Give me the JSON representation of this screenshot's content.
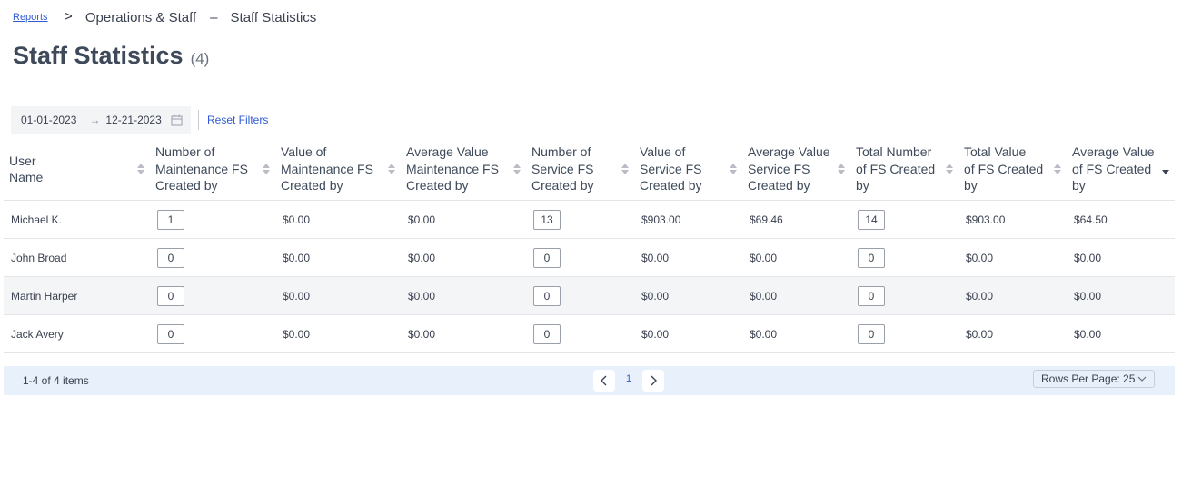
{
  "breadcrumb": {
    "root": "Reports",
    "separator": ">",
    "section": "Operations & Staff",
    "dash": "–",
    "current": "Staff Statistics"
  },
  "page": {
    "title": "Staff Statistics",
    "count": "(4)"
  },
  "filters": {
    "start_date": "01-01-2023",
    "arrow": "→",
    "end_date": "12-21-2023",
    "reset_label": "Reset Filters"
  },
  "table": {
    "columns": [
      [
        "User",
        "Name"
      ],
      [
        "Number of",
        "Maintenance FS",
        "Created by"
      ],
      [
        "Value of",
        "Maintenance FS",
        "Created by"
      ],
      [
        "Average Value",
        "Maintenance FS",
        "Created by"
      ],
      [
        "Number of",
        "Service FS",
        "Created by"
      ],
      [
        "Value of",
        "Service FS",
        "Created by"
      ],
      [
        "Average Value",
        "Service FS",
        "Created by"
      ],
      [
        "Total Number",
        "of FS Created",
        "by"
      ],
      [
        "Total Value",
        "of FS Created",
        "by"
      ],
      [
        "Average Value",
        "of FS Created",
        "by"
      ]
    ],
    "rows": [
      [
        "Michael K.",
        "1",
        "$0.00",
        "$0.00",
        "13",
        "$903.00",
        "$69.46",
        "14",
        "$903.00",
        "$64.50"
      ],
      [
        "John Broad",
        "0",
        "$0.00",
        "$0.00",
        "0",
        "$0.00",
        "$0.00",
        "0",
        "$0.00",
        "$0.00"
      ],
      [
        "Martin Harper",
        "0",
        "$0.00",
        "$0.00",
        "0",
        "$0.00",
        "$0.00",
        "0",
        "$0.00",
        "$0.00"
      ],
      [
        "Jack Avery",
        "0",
        "$0.00",
        "$0.00",
        "0",
        "$0.00",
        "$0.00",
        "0",
        "$0.00",
        "$0.00"
      ]
    ]
  },
  "pagination": {
    "info": "1-4 of 4 items",
    "current_page": "1",
    "rows_per_page_label": "Rows Per Page: 25"
  },
  "icons": {
    "calendar": "calendar-icon",
    "prev": "chevron-left-icon",
    "next": "chevron-right-icon",
    "dropdown": "chevron-down-icon",
    "sort": "sort-icon"
  },
  "colors": {
    "link": "#2f5bd3",
    "pager_bg": "#e8f0fb",
    "shaded_row": "#f4f5f7"
  }
}
